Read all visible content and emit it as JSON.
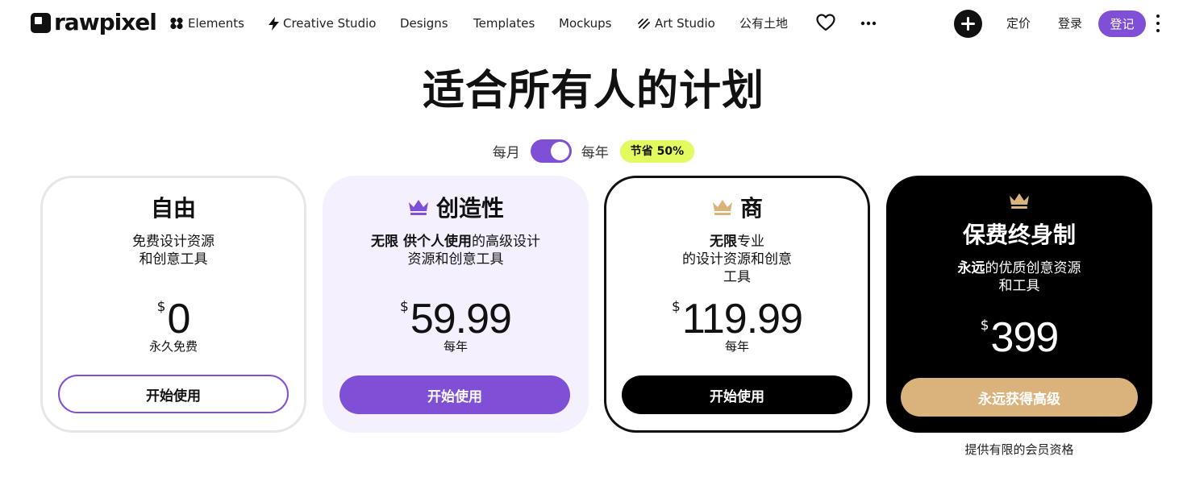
{
  "brand": {
    "name": "rawpixel"
  },
  "nav": {
    "elements": "Elements",
    "creative_studio": "Creative Studio",
    "designs": "Designs",
    "templates": "Templates",
    "mockups": "Mockups",
    "art_studio": "Art Studio",
    "public_domain": "公有土地",
    "pricing": "定价",
    "login": "登录",
    "signup": "登记"
  },
  "hero": {
    "title": "适合所有人的计划",
    "monthly": "每月",
    "yearly": "每年",
    "save_badge": "节省 50%",
    "toggle_state": "yearly"
  },
  "colors": {
    "accent": "#7f4fd6",
    "badge": "#e3fb5e",
    "crown_purple": "#7f4fd6",
    "crown_gold": "#d9b27c",
    "lifetime_button": "#d9b27c"
  },
  "plans": [
    {
      "name": "自由",
      "desc_line1": "免费设计资源",
      "desc_line2": "和创意工具",
      "currency": "$",
      "price": "0",
      "period": "永久免费",
      "cta": "开始使用",
      "icon": null
    },
    {
      "name": "创造性",
      "desc_bold": "无限 供个人使用",
      "desc_rest": "的高级设计",
      "desc_line2": "资源和创意工具",
      "currency": "$",
      "price": "59.99",
      "period": "每年",
      "cta": "开始使用",
      "icon": "crown-icon"
    },
    {
      "name": "商",
      "desc_bold": "无限",
      "desc_rest": "专业",
      "desc_line2": "的设计资源和创意",
      "desc_line3": "工具",
      "currency": "$",
      "price": "119.99",
      "period": "每年",
      "cta": "开始使用",
      "icon": "crown-icon"
    },
    {
      "name": "保费终身制",
      "desc_bold": "永远",
      "desc_rest": "的优质创意资源",
      "desc_line2": "和工具",
      "currency": "$",
      "price": "399",
      "cta": "永远获得高级",
      "icon": "crown-icon"
    }
  ],
  "footnote": "提供有限的会员资格"
}
